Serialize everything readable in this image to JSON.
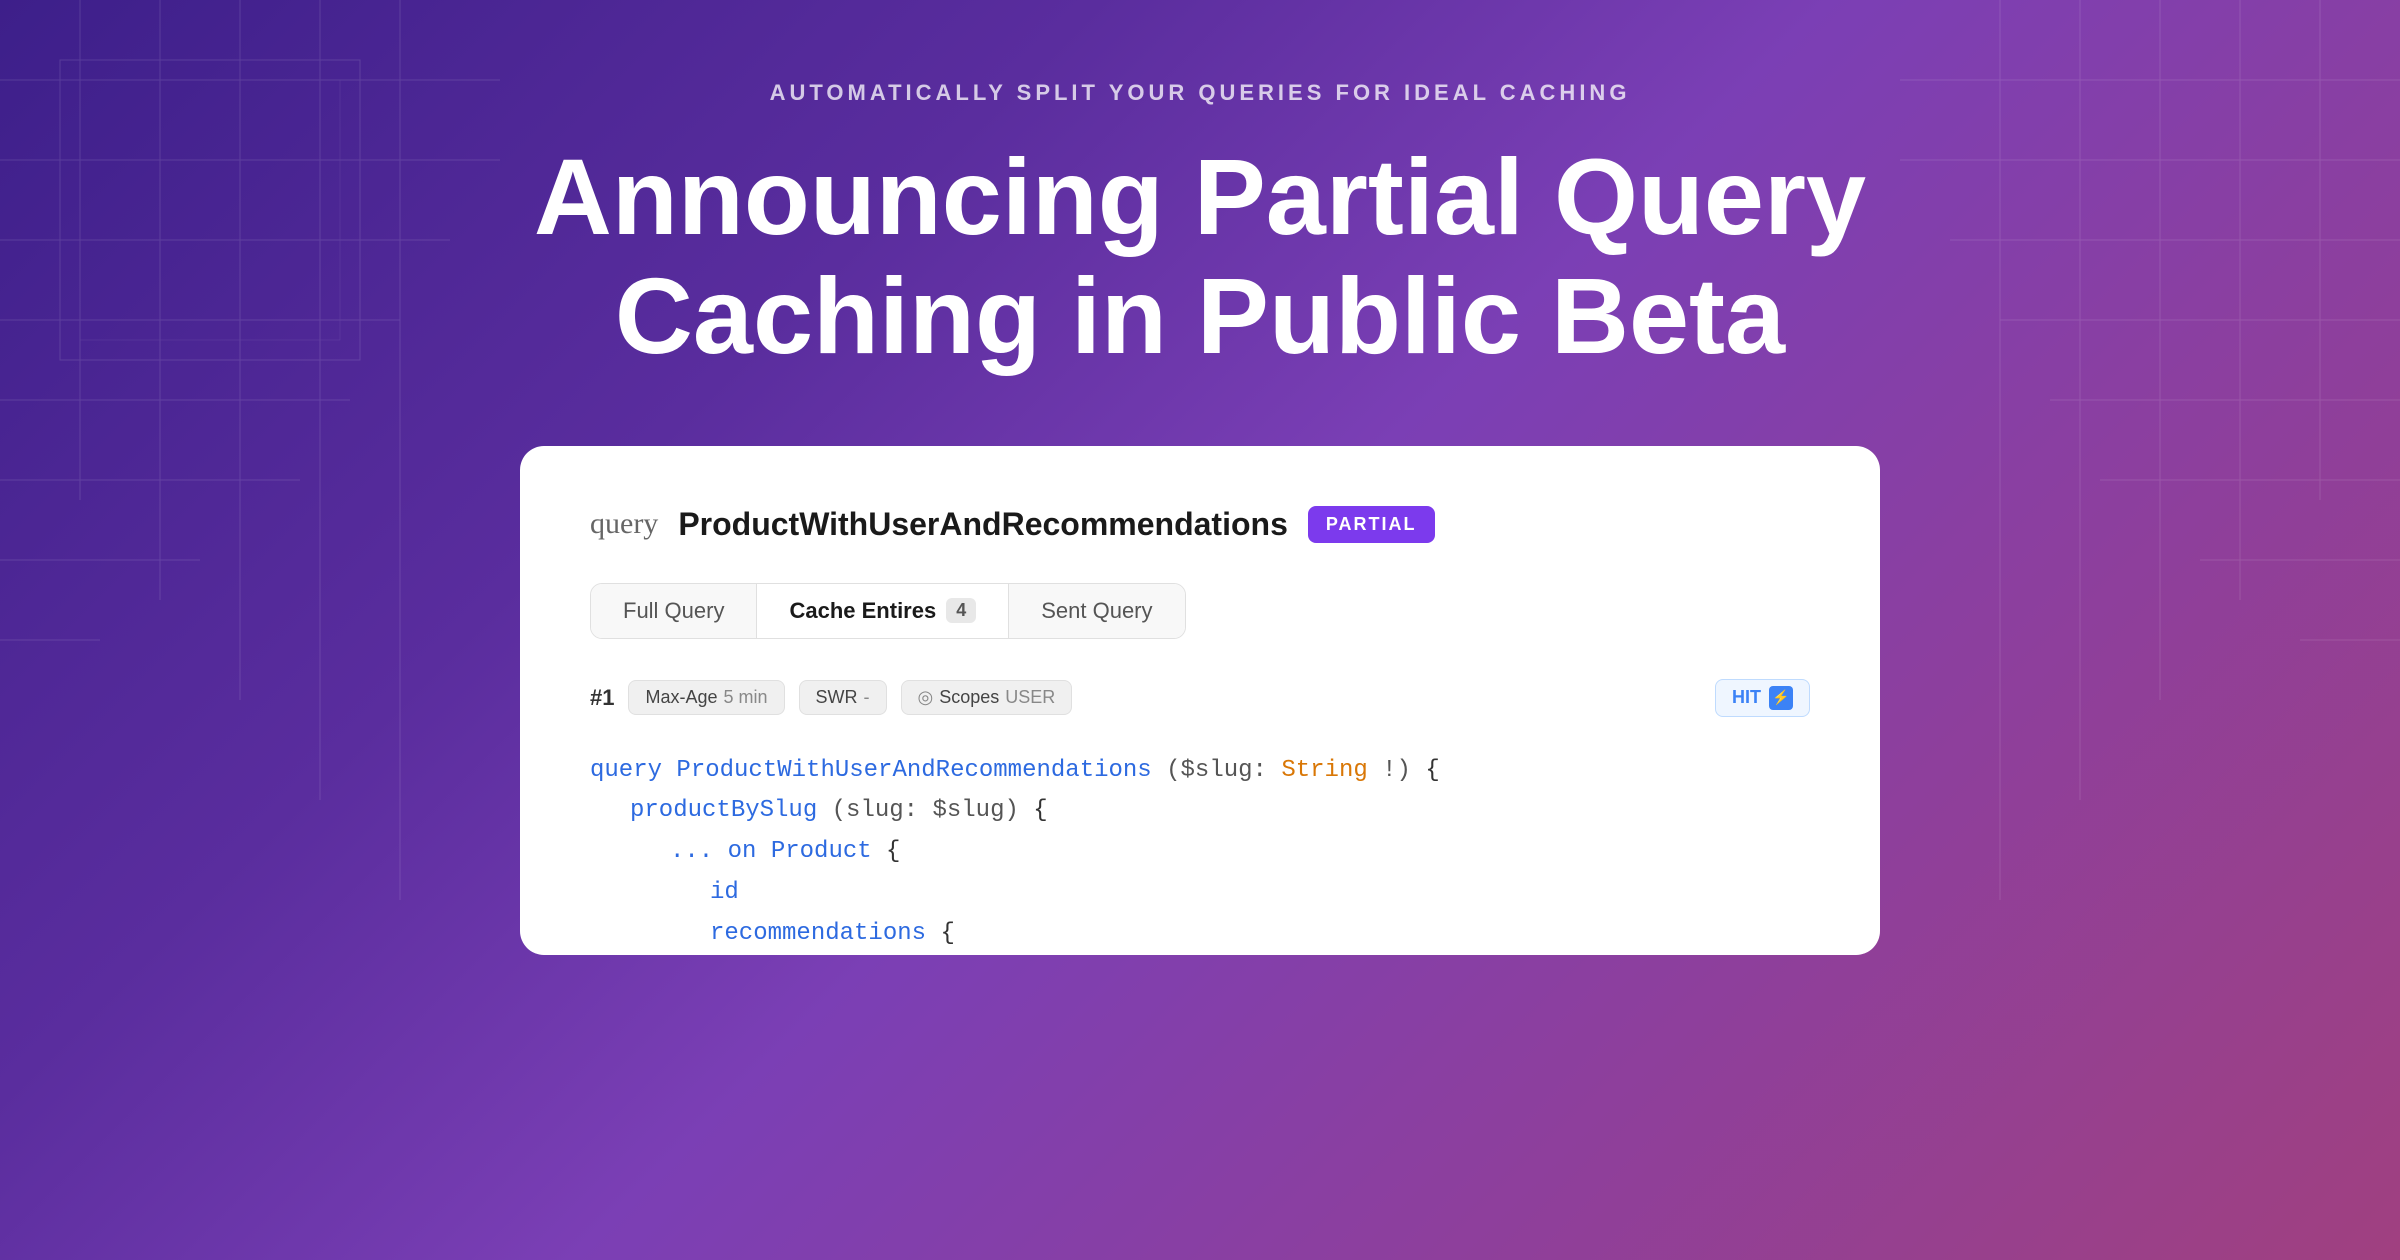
{
  "hero": {
    "subtitle": "AUTOMATICALLY SPLIT YOUR QUERIES FOR IDEAL CACHING",
    "title_line1": "Announcing Partial Query",
    "title_line2": "Caching in Public Beta"
  },
  "card": {
    "query_label": "query",
    "query_name": "ProductWithUserAndRecommendations",
    "partial_badge": "PARTIAL",
    "tabs": [
      {
        "label": "Full Query",
        "active": false,
        "badge": null
      },
      {
        "label": "Cache Entires",
        "active": true,
        "badge": "4"
      },
      {
        "label": "Sent Query",
        "active": false,
        "badge": null
      }
    ],
    "cache_entry": {
      "number": "#1",
      "max_age_label": "Max-Age",
      "max_age_value": "5 min",
      "swr_label": "SWR",
      "swr_value": "-",
      "scopes_label": "Scopes",
      "scopes_value": "USER",
      "hit_label": "HIT",
      "hit_icon": "⚡"
    },
    "code_lines": [
      {
        "indent": 0,
        "content": "query ProductWithUserAndRecommendations ($slug: String!) {"
      },
      {
        "indent": 1,
        "content": "productBySlug(slug: $slug) {"
      },
      {
        "indent": 2,
        "content": "... on Product {"
      },
      {
        "indent": 3,
        "content": "id"
      },
      {
        "indent": 3,
        "content": "recommendations {"
      }
    ]
  }
}
